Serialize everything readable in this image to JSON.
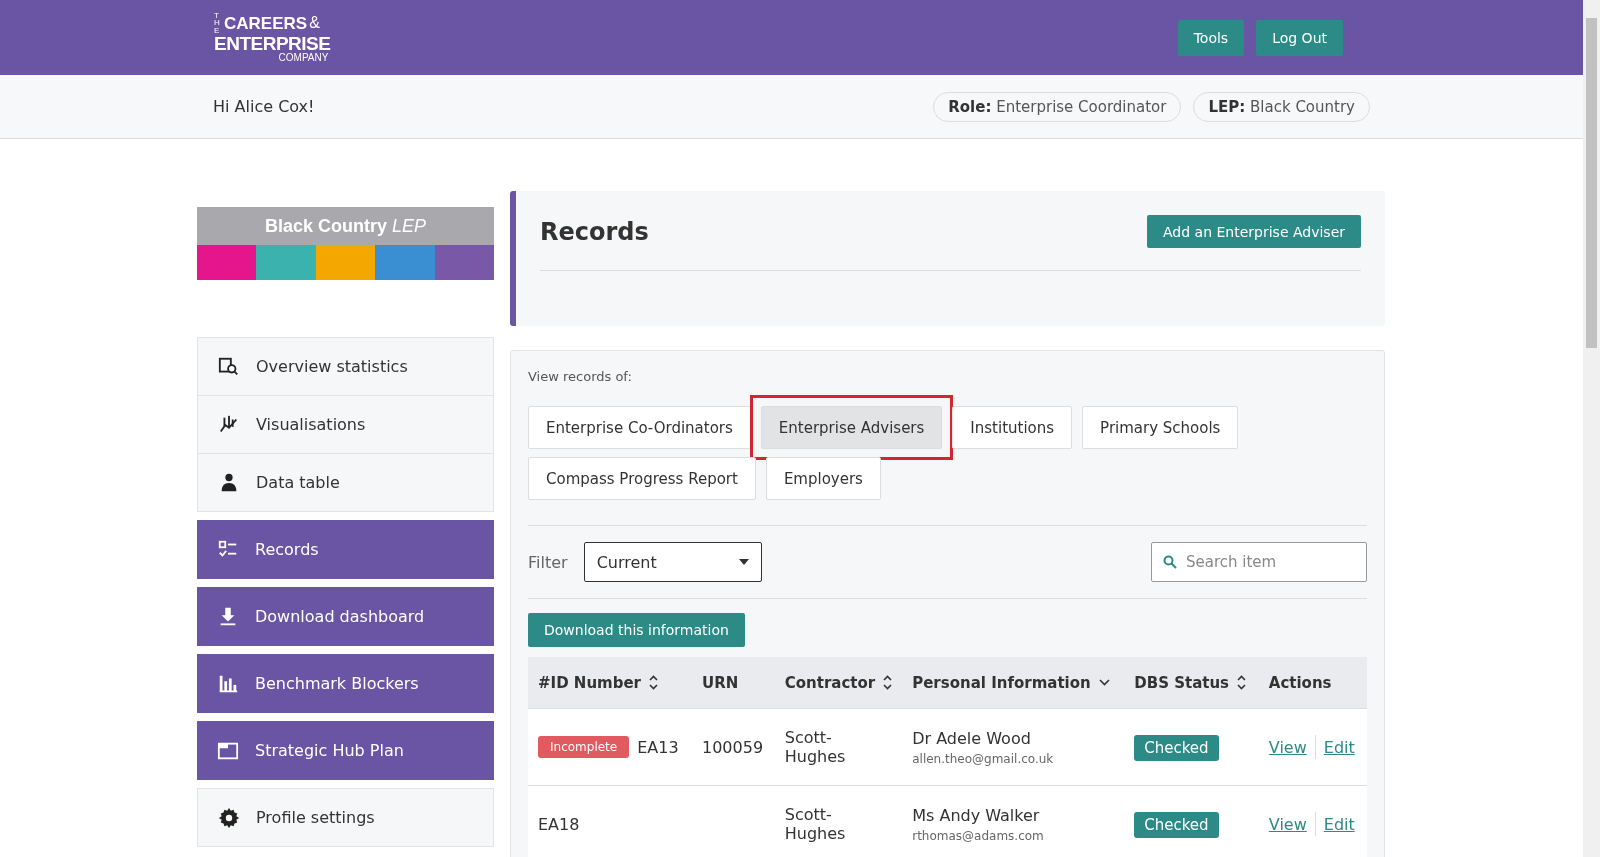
{
  "header": {
    "logo": {
      "small": "THE",
      "line1": "CAREERS",
      "amp": "&",
      "line2": "ENTERPRISE",
      "line3": "COMPANY"
    },
    "buttons": [
      "Tools",
      "Log Out"
    ]
  },
  "greeting": "Hi Alice Cox!",
  "badges": [
    {
      "label": "Role:",
      "value": "Enterprise Coordinator"
    },
    {
      "label": "LEP:",
      "value": "Black Country"
    }
  ],
  "lep_banner": {
    "title": "Black Country",
    "suffix": "LEP",
    "stripes": [
      {
        "color": "#e5168c"
      },
      {
        "color": "#3bb2ad"
      },
      {
        "color": "#f4a700"
      },
      {
        "color": "#3a8fd3"
      },
      {
        "color": "#7a58a8"
      }
    ]
  },
  "sidebar": {
    "items": [
      {
        "label": "Overview statistics",
        "kind": "plain"
      },
      {
        "label": "Visualisations",
        "kind": "plain"
      },
      {
        "label": "Data table",
        "kind": "plain"
      },
      {
        "label": "Records",
        "kind": "accent"
      },
      {
        "label": "Download dashboard",
        "kind": "accent"
      },
      {
        "label": "Benchmark Blockers",
        "kind": "accent"
      },
      {
        "label": "Strategic Hub Plan",
        "kind": "accent"
      },
      {
        "label": "Profile settings",
        "kind": "plain"
      }
    ]
  },
  "records": {
    "title": "Records",
    "add_button": "Add an Enterprise Adviser"
  },
  "view_records_label": "View records of:",
  "tabs": [
    {
      "label": "Enterprise Co-Ordinators",
      "selected": false,
      "highlighted": false
    },
    {
      "label": "Enterprise Advisers",
      "selected": true,
      "highlighted": true
    },
    {
      "label": "Institutions",
      "selected": false,
      "highlighted": false
    },
    {
      "label": "Primary Schools",
      "selected": false,
      "highlighted": false
    },
    {
      "label": "Compass Progress Report",
      "selected": false,
      "highlighted": false
    },
    {
      "label": "Employers",
      "selected": false,
      "highlighted": false
    }
  ],
  "filter": {
    "label": "Filter",
    "value": "Current"
  },
  "search": {
    "placeholder": "Search item"
  },
  "download_button": "Download this information",
  "table": {
    "columns": [
      {
        "label": "#ID Number",
        "kind": "sortable"
      },
      {
        "label": "URN",
        "kind": "plain"
      },
      {
        "label": "Contractor",
        "kind": "sortable"
      },
      {
        "label": "Personal Information",
        "kind": "dropdown"
      },
      {
        "label": "DBS Status",
        "kind": "sortable"
      },
      {
        "label": "Actions",
        "kind": "plain"
      }
    ],
    "rows": [
      {
        "status": "Incomplete",
        "id": "EA13",
        "urn": "100059",
        "contractor": "Scott-Hughes",
        "name": "Dr Adele Wood",
        "email": "allen.theo@gmail.co.uk",
        "dbs": "Checked",
        "actions": [
          "View",
          "Edit"
        ]
      },
      {
        "id": "EA18",
        "contractor": "Scott-Hughes",
        "name": "Ms Andy Walker",
        "email": "rthomas@adams.com",
        "dbs": "Checked",
        "actions": [
          "View",
          "Edit"
        ]
      }
    ]
  }
}
